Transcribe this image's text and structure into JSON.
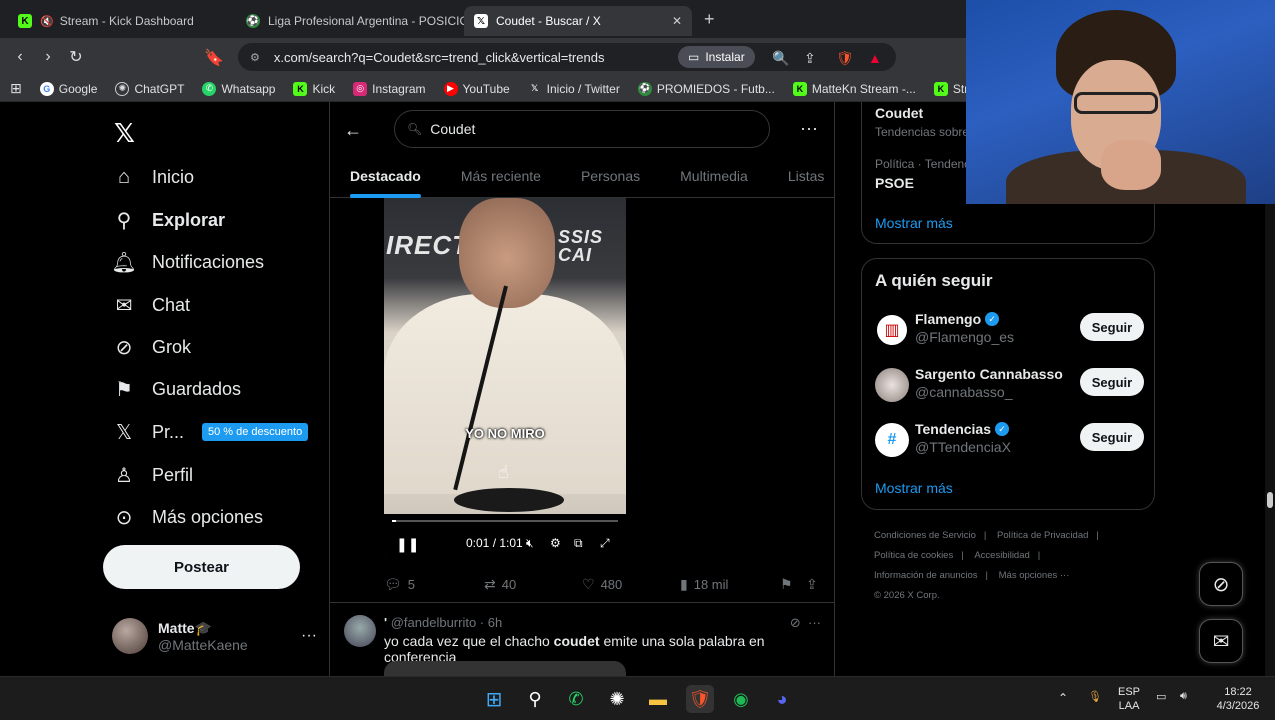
{
  "browser": {
    "tabs": [
      {
        "title": "Stream - Kick Dashboard",
        "active": false
      },
      {
        "title": "Liga Profesional Argentina - POSICIO",
        "active": false
      },
      {
        "title": "Coudet - Buscar / X",
        "active": true
      }
    ],
    "url": "x.com/search?q=Coudet&src=trend_click&vertical=trends",
    "install_label": "Instalar",
    "bookmarks": [
      "Google",
      "ChatGPT",
      "Whatsapp",
      "Kick",
      "Instagram",
      "YouTube",
      "Inicio / Twitter",
      "PROMIEDOS - Futb...",
      "MatteKn Stream -...",
      "Stream"
    ]
  },
  "nav": {
    "items": [
      {
        "label": "Inicio",
        "icon": "home-icon"
      },
      {
        "label": "Explorar",
        "icon": "search-icon",
        "bold": true
      },
      {
        "label": "Notificaciones",
        "icon": "bell-icon"
      },
      {
        "label": "Chat",
        "icon": "mail-icon"
      },
      {
        "label": "Grok",
        "icon": "grok-icon"
      },
      {
        "label": "Guardados",
        "icon": "bookmark-icon"
      },
      {
        "label": "Pr...",
        "icon": "x-premium-icon"
      },
      {
        "label": "Perfil",
        "icon": "person-icon"
      },
      {
        "label": "Más opciones",
        "icon": "more-circle-icon"
      }
    ],
    "promo_badge": "50 % de descuento",
    "post_button": "Postear",
    "account": {
      "name": "Matte🎓",
      "handle": "@MatteKaene"
    }
  },
  "search": {
    "query": "Coudet",
    "tabs": [
      "Destacado",
      "Más reciente",
      "Personas",
      "Multimedia",
      "Listas"
    ],
    "active_tab": "Destacado"
  },
  "tweet1": {
    "video": {
      "banner_text": "IRECT",
      "banner_text_right": "SSIS CAI",
      "caption": "YO NO MIRO",
      "time": "0:01 / 1:01",
      "progress": 0.016
    },
    "actions": {
      "replies": "5",
      "reposts": "40",
      "likes": "480",
      "views": "18 mil"
    }
  },
  "tweet2": {
    "name": "'",
    "handle": "@fandelburrito",
    "time": "6h",
    "text_before": "yo cada vez que el chacho ",
    "text_bold": "coudet",
    "text_after": " emite una sola palabra en conferencia"
  },
  "trends": {
    "items": [
      {
        "name": "Coudet",
        "meta": "Tendencias sobre..."
      },
      {
        "meta": "Política · Tendenci...",
        "name": "PSOE"
      }
    ],
    "show_more": "Mostrar más"
  },
  "who_to_follow": {
    "title": "A quién seguir",
    "follow_label": "Seguir",
    "users": [
      {
        "name": "Flamengo",
        "handle": "@Flamengo_es",
        "verified": true
      },
      {
        "name": "Sargento Cannabasso",
        "handle": "@cannabasso_",
        "verified": false
      },
      {
        "name": "Tendencias",
        "handle": "@TTendenciaX",
        "verified": true
      }
    ],
    "show_more": "Mostrar más"
  },
  "footer": {
    "links": [
      "Condiciones de Servicio",
      "Política de Privacidad",
      "Política de cookies",
      "Accesibilidad",
      "Información de anuncios",
      "Más opciones ···"
    ],
    "copyright": "© 2026 X Corp."
  },
  "taskbar": {
    "lang_top": "ESP",
    "lang_bottom": "LAA",
    "time": "18:22",
    "date": "4/3/2026"
  },
  "colors": {
    "accent": "#1d9bf0",
    "background": "#000000",
    "muted": "#71767b"
  }
}
